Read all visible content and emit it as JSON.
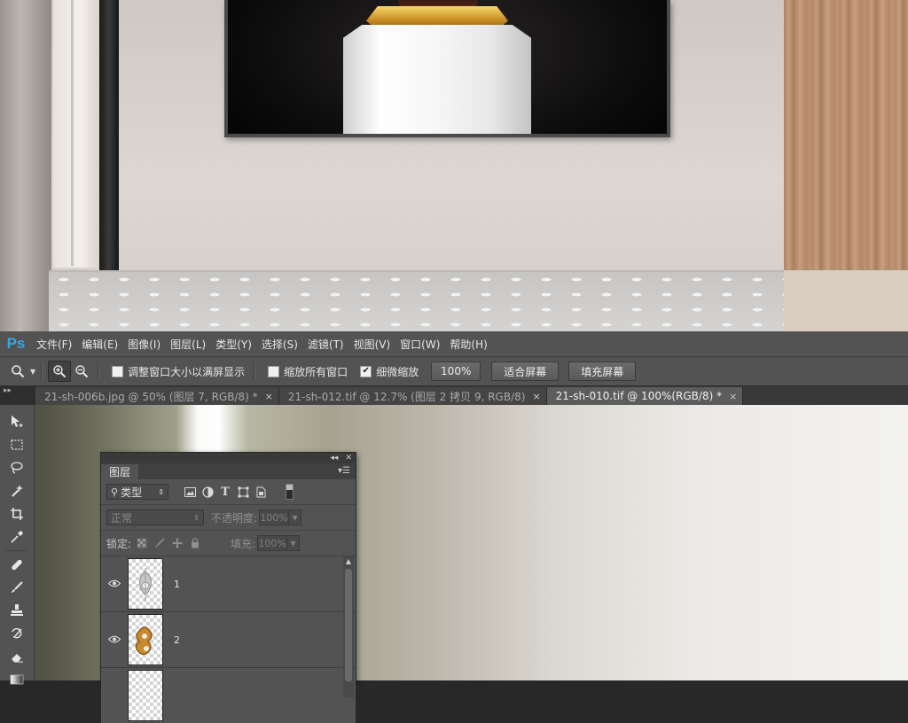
{
  "app": {
    "logo": "Ps"
  },
  "menu": [
    "文件(F)",
    "编辑(E)",
    "图像(I)",
    "图层(L)",
    "类型(Y)",
    "选择(S)",
    "滤镜(T)",
    "视图(V)",
    "窗口(W)",
    "帮助(H)"
  ],
  "options": {
    "tool_icon": "zoom-icon",
    "chk_resize": "调整窗口大小以满屏显示",
    "chk_resize_checked": false,
    "chk_zoom_all": "缩放所有窗口",
    "chk_zoom_all_checked": false,
    "chk_scrubby": "细微缩放",
    "chk_scrubby_checked": true,
    "btn_100": "100%",
    "btn_fit": "适合屏幕",
    "btn_fill": "填充屏幕"
  },
  "tabs": [
    {
      "label": "21-sh-006b.jpg @ 50% (图层 7, RGB/8) *",
      "active": false
    },
    {
      "label": "21-sh-012.tif @ 12.7% (图层 2 拷贝 9, RGB/8)",
      "active": false
    },
    {
      "label": "21-sh-010.tif @ 100%(RGB/8) *",
      "active": true
    }
  ],
  "tab_close": "×",
  "layers_panel": {
    "title": "图层",
    "filter_label": "类型",
    "blend_mode": "正常",
    "opacity_label": "不透明度:",
    "opacity_value": "100%",
    "lock_label": "锁定:",
    "fill_label": "填充:",
    "fill_value": "100%",
    "layers": [
      {
        "name": "1",
        "visible": true,
        "thumb": "silver-ornament"
      },
      {
        "name": "2",
        "visible": true,
        "thumb": "gold-ornament"
      },
      {
        "name": "",
        "visible": false,
        "thumb": "partial"
      }
    ]
  },
  "colors": {
    "ps_blue": "#35a6e0",
    "panel_bg": "#535353",
    "menubar_bg": "#535353"
  }
}
